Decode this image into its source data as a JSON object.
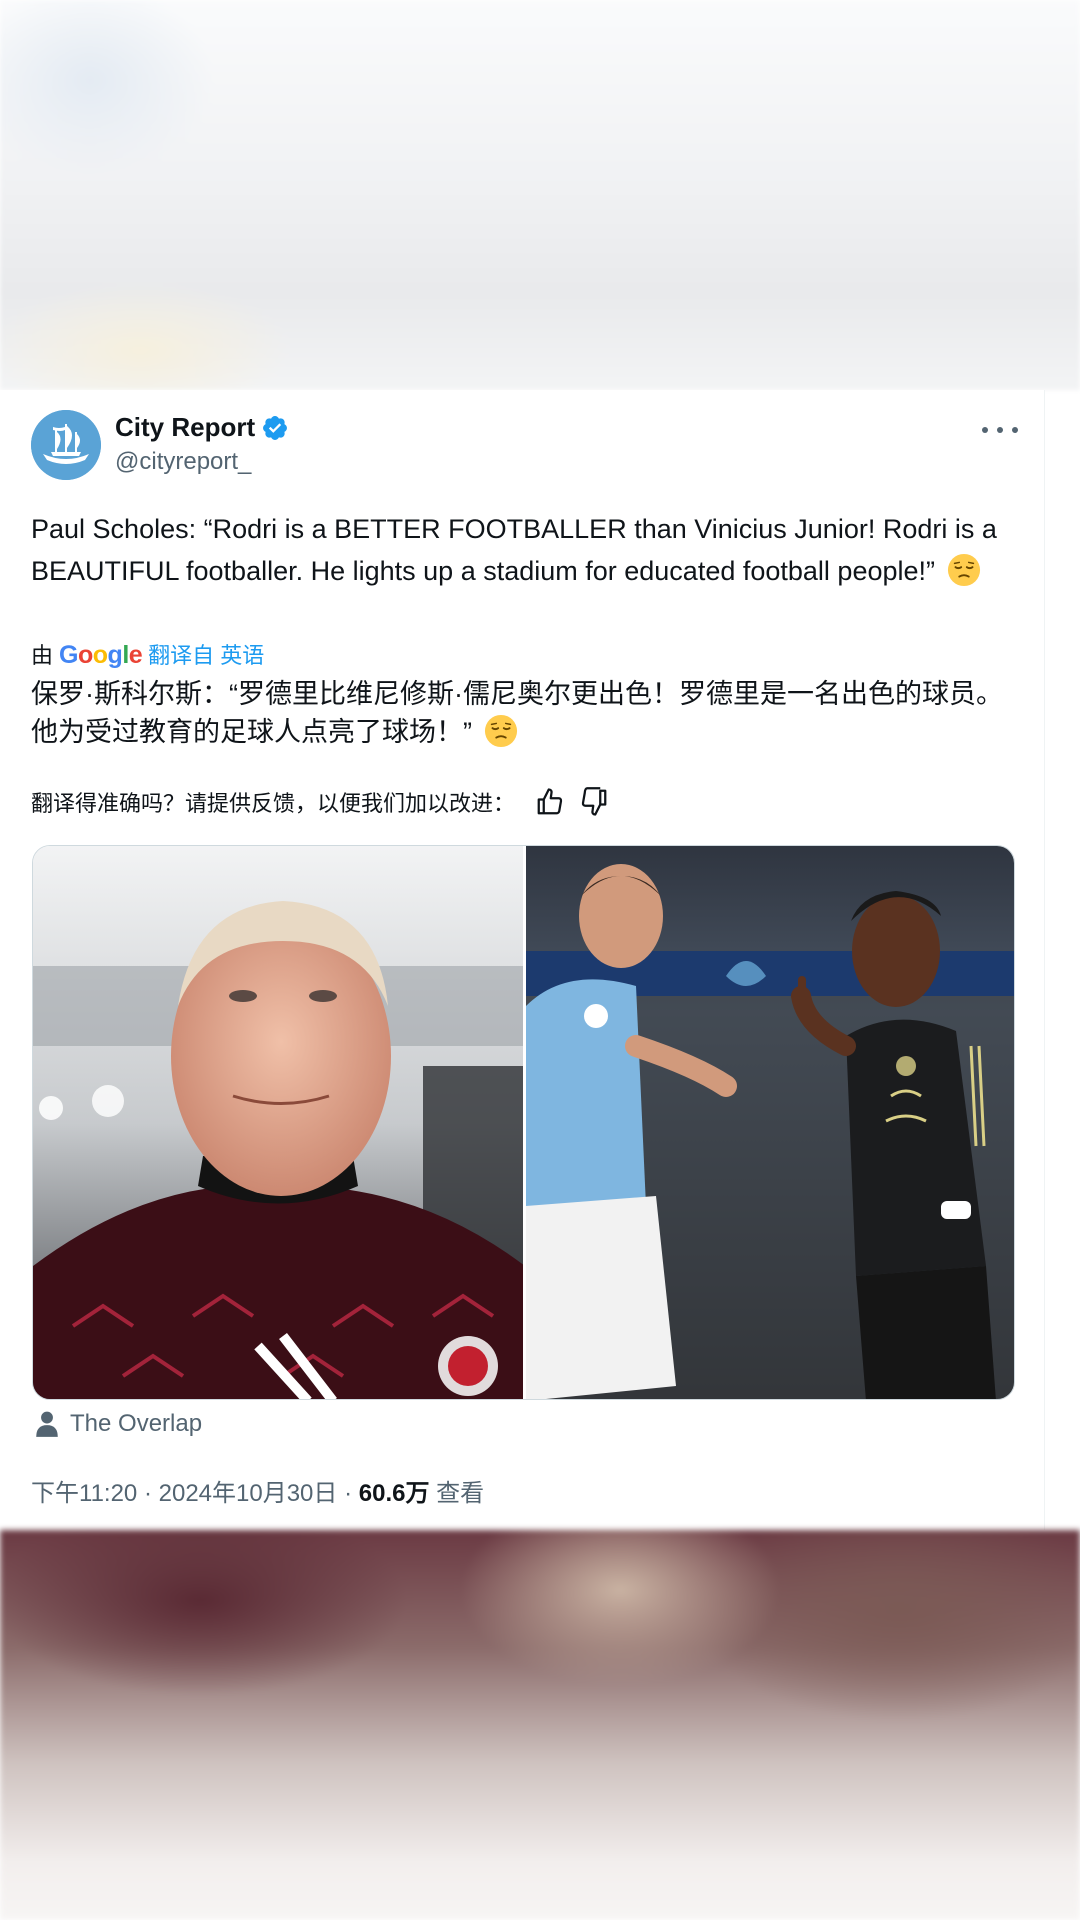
{
  "tweet": {
    "display_name": "City Report",
    "handle": "@cityreport_",
    "text_en": "Paul Scholes: “Rodri is a BETTER FOOTBALLER than Vinicius Junior! Rodri is a BEAUTIFUL footballer. He lights up a stadium for educated football people!”",
    "translate_prefix": "由",
    "google": {
      "G": "G",
      "o1": "o",
      "o2": "o",
      "g": "g",
      "l": "l",
      "e": "e"
    },
    "translate_link": "翻译自 英语",
    "text_zh": "保罗·斯科尔斯：“罗德里比维尼修斯·儒尼奥尔更出色！罗德里是一名出色的球员。他为受过教育的足球人点亮了球场！”",
    "feedback_prompt": "翻译得准确吗？请提供反馈，以便我们加以改进：",
    "media_credit": "The Overlap",
    "time": "下午11:20",
    "date": "2024年10月30日",
    "separator": "·",
    "views_count": "60.6万",
    "views_label": "查看"
  },
  "icons": {
    "verified": "verified-badge-icon",
    "more": "more-options-icon",
    "thumbs_up": "thumbs-up-icon",
    "thumbs_down": "thumbs-down-icon",
    "person": "person-icon",
    "emoji": "relieved-face-emoji"
  },
  "colors": {
    "accent": "#1d9bf0",
    "text_primary": "#0f1419",
    "text_secondary": "#536471",
    "avatar_bg": "#5aa3d6"
  }
}
